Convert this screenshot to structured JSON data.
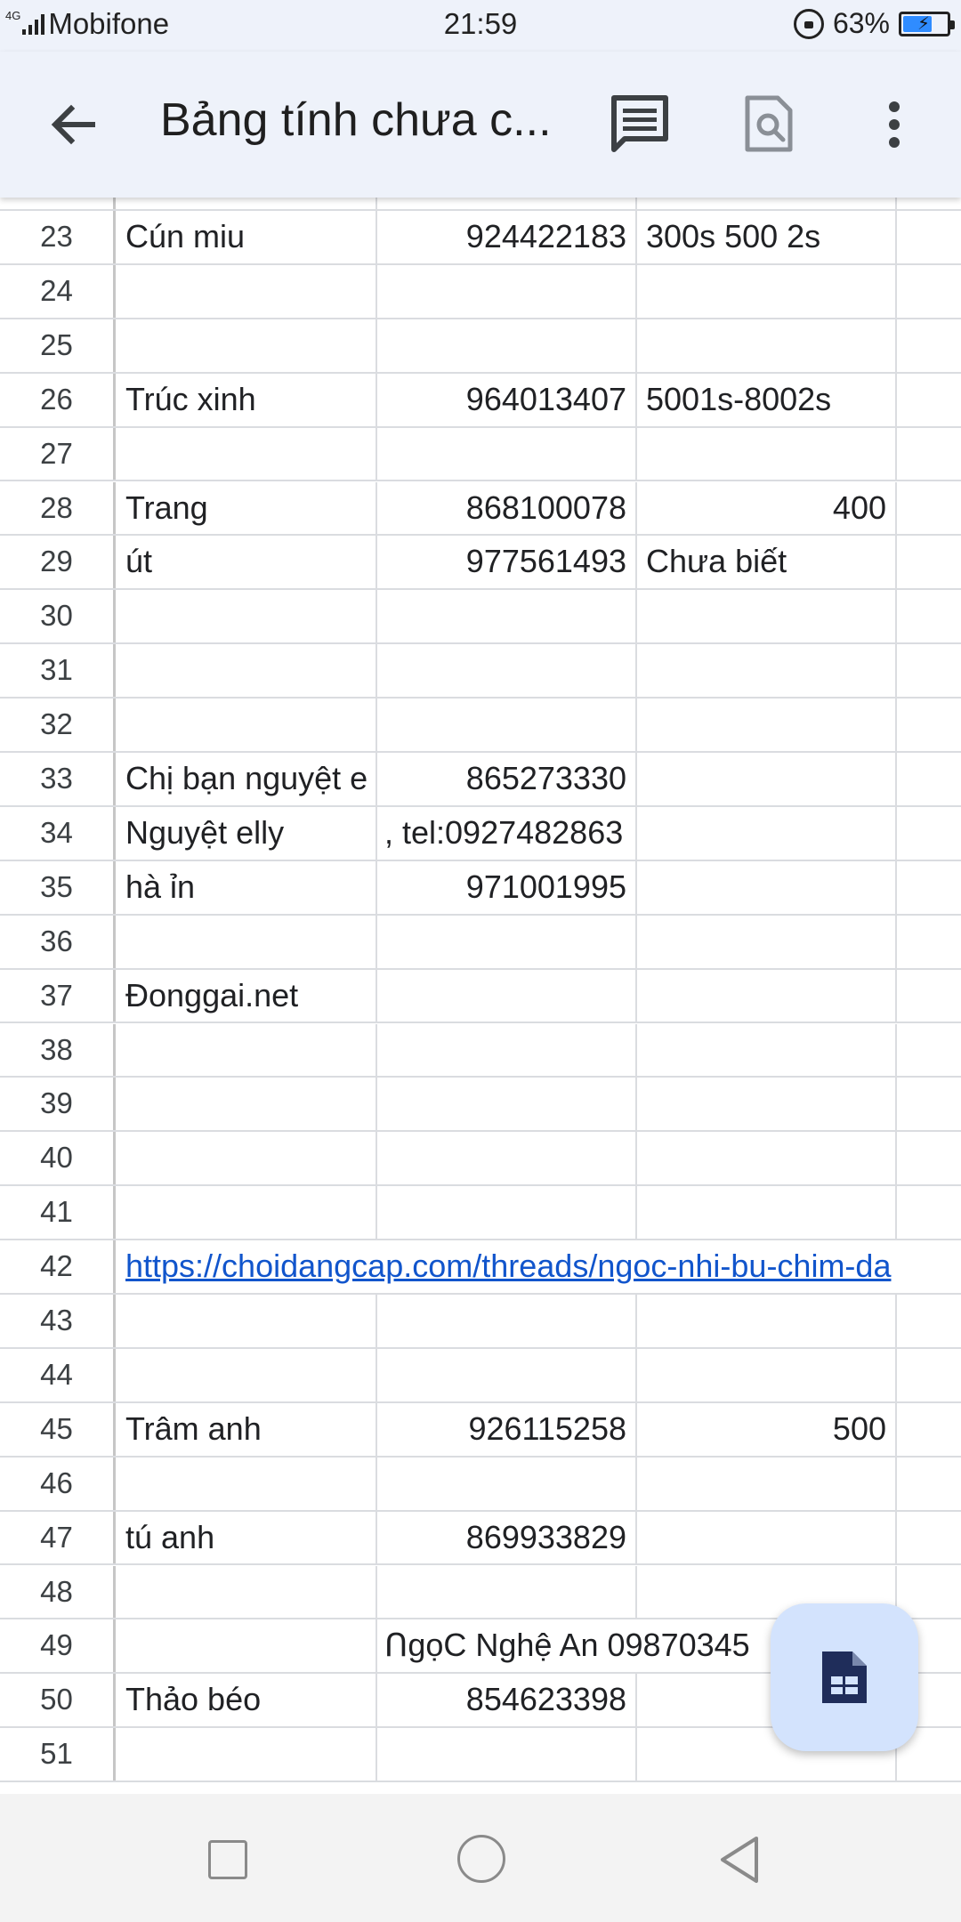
{
  "status_bar": {
    "network": "4G",
    "carrier": "Mobifone",
    "time": "21:59",
    "battery_percent": "63%",
    "battery_level": 0.63
  },
  "app_bar": {
    "title": "Bảng tính chưa c...",
    "icons": [
      "back-arrow-icon",
      "comment-icon",
      "preview-icon",
      "more-vert-icon"
    ]
  },
  "sheet": {
    "rows": [
      {
        "num": "23",
        "c1": "Cún miu",
        "c2": "924422183",
        "c3": "300s 500 2s",
        "c3_align": "left"
      },
      {
        "num": "24",
        "c1": "",
        "c2": "",
        "c3": ""
      },
      {
        "num": "25",
        "c1": "",
        "c2": "",
        "c3": ""
      },
      {
        "num": "26",
        "c1": "Trúc xinh",
        "c2": "964013407",
        "c3": "5001s-8002s",
        "c3_align": "left"
      },
      {
        "num": "27",
        "c1": "",
        "c2": "",
        "c3": ""
      },
      {
        "num": "28",
        "c1": "Trang",
        "c2": "868100078",
        "c3": "400",
        "c3_align": "right"
      },
      {
        "num": "29",
        "c1": "út",
        "c2": "977561493",
        "c3": "Chưa biết",
        "c3_align": "left"
      },
      {
        "num": "30",
        "c1": "",
        "c2": "",
        "c3": ""
      },
      {
        "num": "31",
        "c1": "",
        "c2": "",
        "c3": ""
      },
      {
        "num": "32",
        "c1": "",
        "c2": "",
        "c3": ""
      },
      {
        "num": "33",
        "c1": "Chị bạn nguyệt e",
        "c2": "865273330",
        "c3": ""
      },
      {
        "num": "34",
        "c1": "Nguyệt elly",
        "c2": ", tel:0927482863",
        "c2_align": "left",
        "c3": ""
      },
      {
        "num": "35",
        "c1": "hà ỉn",
        "c2": "971001995",
        "c3": ""
      },
      {
        "num": "36",
        "c1": "",
        "c2": "",
        "c3": ""
      },
      {
        "num": "37",
        "c1": "Đonggai.net",
        "c2": "",
        "c3": ""
      },
      {
        "num": "38",
        "c1": "",
        "c2": "",
        "c3": ""
      },
      {
        "num": "39",
        "c1": "",
        "c2": "",
        "c3": ""
      },
      {
        "num": "40",
        "c1": "",
        "c2": "",
        "c3": ""
      },
      {
        "num": "41",
        "c1": "",
        "c2": "",
        "c3": ""
      },
      {
        "num": "42",
        "link": "https://choidangcap.com/threads/ngoc-nhi-bu-chim-da"
      },
      {
        "num": "43",
        "c1": "",
        "c2": "",
        "c3": ""
      },
      {
        "num": "44",
        "c1": "",
        "c2": "",
        "c3": ""
      },
      {
        "num": "45",
        "c1": "Trâm anh",
        "c2": "926115258",
        "c3": "500",
        "c3_align": "right"
      },
      {
        "num": "46",
        "c1": "",
        "c2": "",
        "c3": ""
      },
      {
        "num": "47",
        "c1": "tú anh",
        "c2": "869933829",
        "c3": ""
      },
      {
        "num": "48",
        "c1": "",
        "c2": "",
        "c3": ""
      },
      {
        "num": "49",
        "c1": "",
        "c2_overflow": "ՈgọC Nghệ An 09870345",
        "c3": ""
      },
      {
        "num": "50",
        "c1": "Thảo béo",
        "c2": "854623398",
        "c3": ""
      },
      {
        "num": "51",
        "c1": "",
        "c2": "",
        "c3": ""
      }
    ]
  },
  "fab": {
    "icon": "sheets-doc-icon"
  },
  "nav_bar": {
    "icons": [
      "recent-apps-icon",
      "home-icon",
      "back-icon"
    ]
  },
  "colors": {
    "app_bar_bg": "#eef2fa",
    "fab_bg": "#d3e3fd",
    "link": "#1155cc",
    "grid_line": "#dadce0"
  }
}
